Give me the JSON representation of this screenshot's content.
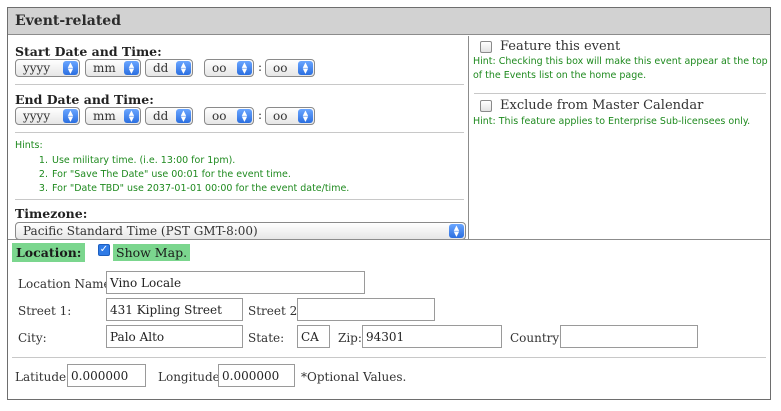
{
  "section": {
    "title": "Event-related"
  },
  "start": {
    "label": "Start Date and Time:",
    "year": "yyyy",
    "month": "mm",
    "day": "dd",
    "hour": "oo",
    "minute": "oo"
  },
  "end": {
    "label": "End Date and Time:",
    "year": "yyyy",
    "month": "mm",
    "day": "dd",
    "hour": "oo",
    "minute": "oo"
  },
  "time_separator": ":",
  "hints": {
    "title": "Hints:",
    "items": [
      {
        "num": "1.",
        "text": "Use military time. (i.e. 13:00 for 1pm)."
      },
      {
        "num": "2.",
        "text": "For \"Save The Date\" use 00:01 for the event time."
      },
      {
        "num": "3.",
        "text": "For \"Date TBD\" use 2037-01-01 00:00 for the event date/time."
      }
    ]
  },
  "timezone": {
    "label": "Timezone:",
    "value": "Pacific Standard Time (PST GMT-8:00)"
  },
  "feature": {
    "label": "Feature this event",
    "checked": false,
    "hint": "Hint: Checking this box will make this event appear at the top of the Events list on the home page."
  },
  "exclude": {
    "label": "Exclude from Master Calendar",
    "checked": false,
    "hint": "Hint: This feature applies to Enterprise Sub-licensees only."
  },
  "location": {
    "title": "Location:",
    "show_map_label": "Show Map.",
    "show_map_checked": true,
    "name_label": "Location Name:",
    "name_value": "Vino Locale",
    "street1_label": "Street 1:",
    "street1_value": "431 Kipling Street",
    "street2_label": "Street 2:",
    "street2_value": "",
    "city_label": "City:",
    "city_value": "Palo Alto",
    "state_label": "State:",
    "state_value": "CA",
    "zip_label": "Zip:",
    "zip_value": "94301",
    "country_label": "Country:",
    "country_value": "",
    "latitude_label": "Latitude:",
    "latitude_value": "0.000000",
    "longitude_label": "Longitude:",
    "longitude_value": "0.000000",
    "optional_note": "*Optional Values."
  },
  "icons": {
    "select_arrows": "updown-arrows-icon",
    "checkmark": "checkmark-icon"
  }
}
